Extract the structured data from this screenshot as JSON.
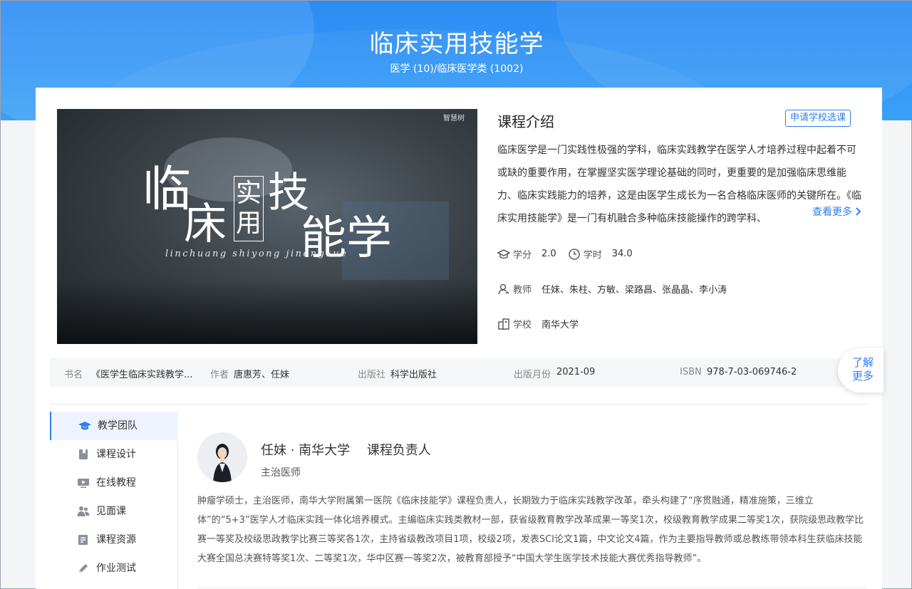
{
  "header": {
    "title": "临床实用技能学",
    "category": "医学 (10)/临床医学类 (1002)"
  },
  "cover": {
    "brand": "智慧树",
    "title_chars": [
      "临",
      "床",
      "实",
      "用",
      "技",
      "能",
      "学"
    ],
    "pinyin": "linchuang shiyong jinengxue"
  },
  "intro": {
    "title": "课程介绍",
    "apply_label": "申请学校选课",
    "text": "临床医学是一门实践性极强的学科，临床实践教学在医学人才培养过程中起着不可或缺的重要作用，在掌握坚实医学理论基础的同时，更重要的是加强临床思维能力、临床实践能力的培养，这是由医学生成长为一名合格临床医师的关键所在。《临床实用技能学》是一门有机融合多种临床技能操作的跨学科、",
    "see_more": "查看更多"
  },
  "meta": {
    "credit_label": "学分",
    "credit_value": "2.0",
    "hours_label": "学时",
    "hours_value": "34.0",
    "teacher_label": "教师",
    "teacher_value": "任妹、朱柱、方敏、梁路昌、张晶晶、李小涛",
    "school_label": "学校",
    "school_value": "南华大学"
  },
  "book": {
    "name_label": "书名",
    "name_value": "《医学生临床实践教学...",
    "author_label": "作者",
    "author_value": "唐惠芳、任妹",
    "publisher_label": "出版社",
    "publisher_value": "科学出版社",
    "date_label": "出版月份",
    "date_value": "2021-09",
    "isbn_label": "ISBN",
    "isbn_value": "978-7-03-069746-2"
  },
  "learn_more": [
    "了解",
    "更多"
  ],
  "sidebar": {
    "items": [
      {
        "label": "教学团队",
        "icon": "graduation-cap-icon"
      },
      {
        "label": "课程设计",
        "icon": "bookmark-icon"
      },
      {
        "label": "在线教程",
        "icon": "video-play-icon"
      },
      {
        "label": "见面课",
        "icon": "people-icon"
      },
      {
        "label": "课程资源",
        "icon": "document-list-icon"
      },
      {
        "label": "作业测试",
        "icon": "pencil-icon"
      }
    ]
  },
  "teacher": {
    "name": "任妹 · 南华大学",
    "role": "课程负责人",
    "title": "主治医师",
    "bio": "肿瘤学硕士，主治医师，南华大学附属第一医院《临床技能学》课程负责人，长期致力于临床实践教学改革，牵头构建了“序贯融通，精准施策，三维立体”的“5+3”医学人才临床实践一体化培养模式。主编临床实践类教材一部，获省级教育教学改革成果一等奖1次，校级教育教学成果二等奖1次，获院级思政教学比赛一等奖及校级思政教学比赛三等奖各1次，主持省级教改项目1项，校级2项，发表SCI论文1篇，中文论文4篇，作为主要指导教师或总教练带领本科生获临床技能大赛全国总决赛特等奖1次、二等奖1次，华中区赛一等奖2次，被教育部授予“中国大学生医学技术技能大赛优秀指导教师”。"
  },
  "colors": {
    "accent": "#2f7ff0",
    "hero": "#3aa0f7"
  }
}
